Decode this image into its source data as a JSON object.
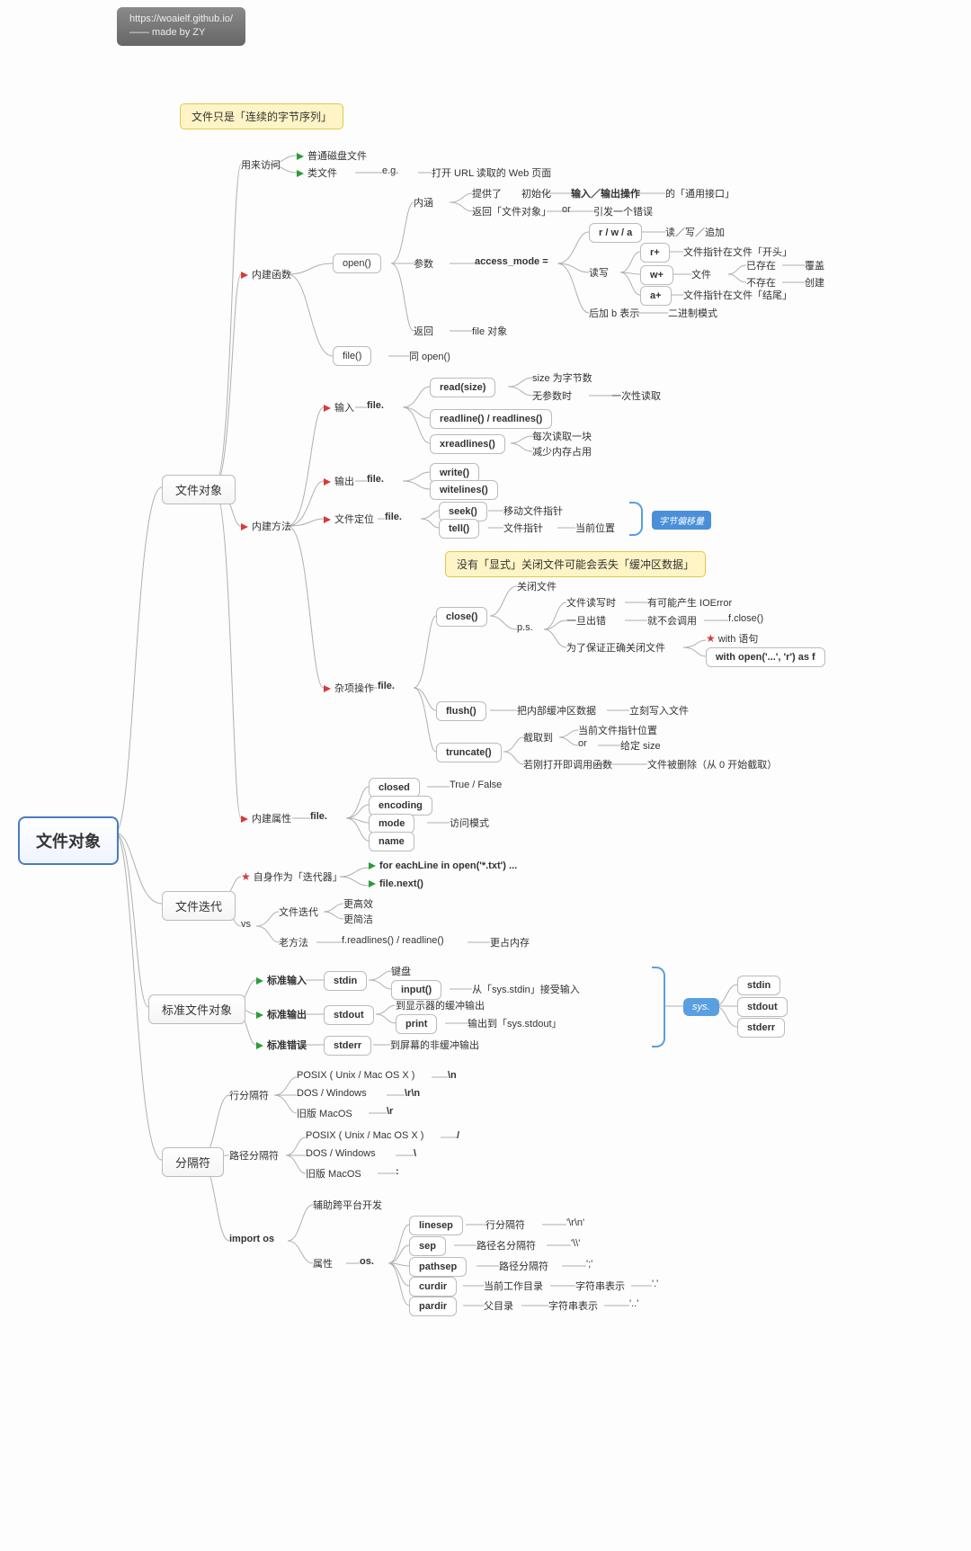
{
  "header": {
    "url": "https://woaielf.github.io/",
    "madeby": "—— made by ZY"
  },
  "root": "文件对象",
  "callouts": {
    "top": "文件只是「连续的字节序列」",
    "close": "没有「显式」关闭文件可能会丢失「缓冲区数据」",
    "offset": "字节偏移量"
  },
  "m1": {
    "title": "文件对象",
    "access": {
      "label": "用来访问",
      "a1": "普通磁盘文件",
      "a2": "类文件",
      "eg": "e.g.",
      "eg1": "打开 URL 读取的 Web 页面"
    },
    "builtinFunc": {
      "label": "内建函数",
      "open": "open()",
      "file": "file()",
      "sameopen": "同 open()",
      "inner": "内涵",
      "inner1": "提供了",
      "inner2": "初始化",
      "inner3": "输入／输出操作",
      "inner4": "的「通用接口」",
      "inner5": "返回「文件对象」",
      "inner6": "or",
      "inner7": "引发一个错误",
      "args": "参数",
      "access": "access_mode =",
      "rwa": "r / w / a",
      "rwa1": "读／写／追加",
      "rw": "读写",
      "rp": "r+",
      "rp1": "文件指针在文件「开头」",
      "wp": "w+",
      "wpf": "文件",
      "wpe": "已存在",
      "wpo": "覆盖",
      "wpne": "不存在",
      "wpc": "创建",
      "ap": "a+",
      "ap1": "文件指针在文件「结尾」",
      "bmode": "后加 b 表示",
      "bmode1": "二进制模式",
      "ret": "返回",
      "retv": "file 对象"
    },
    "builtinMethod": {
      "label": "内建方法",
      "input": "输入",
      "filep": "file.",
      "readsize": "read(size)",
      "rs1": "size 为字节数",
      "rs2": "无参数时",
      "rs3": "一次性读取",
      "readline": "readline() / readlines()",
      "xread": "xreadlines()",
      "xr1": "每次读取一块",
      "xr2": "减少内存占用",
      "output": "输出",
      "write": "write()",
      "writelines": "witelines()",
      "seek": "文件定位",
      "seekf": "seek()",
      "seek1": "移动文件指针",
      "tellf": "tell()",
      "tell1": "文件指针",
      "tell2": "当前位置",
      "misc": "杂项操作",
      "close": "close()",
      "close1": "关闭文件",
      "closeps": "p.s.",
      "c2": "文件读写时",
      "c3": "有可能产生 IOError",
      "c4": "一旦出错",
      "c5": "就不会调用",
      "c6": "f.close()",
      "c7": "为了保证正确关闭文件",
      "c8": "with 语句",
      "c9": "with open('...', 'r') as f",
      "flush": "flush()",
      "fl1": "把内部缓冲区数据",
      "fl2": "立刻写入文件",
      "trunc": "truncate()",
      "tr1": "截取到",
      "tr2": "当前文件指针位置",
      "tr3": "or",
      "tr4": "给定 size",
      "tr5": "若刚打开即调用函数",
      "tr6": "文件被删除（从 0 开始截取）"
    },
    "builtinAttr": {
      "label": "内建属性",
      "filep": "file.",
      "closed": "closed",
      "cv": "True / False",
      "encoding": "encoding",
      "mode": "mode",
      "mv": "访问模式",
      "name": "name"
    }
  },
  "m2": {
    "title": "文件迭代",
    "self": "自身作为「迭代器」",
    "fe": "for eachLine in open('*.txt') ...",
    "fn": "file.next()",
    "vs": "vs",
    "fi": "文件迭代",
    "fi1": "更高效",
    "fi2": "更简洁",
    "old": "老方法",
    "old1": "f.readlines() / readline()",
    "old2": "更占内存"
  },
  "m3": {
    "title": "标准文件对象",
    "si": "标准输入",
    "stdin": "stdin",
    "si1": "键盘",
    "si2": "input()",
    "si3": "从「sys.stdin」接受输入",
    "so": "标准输出",
    "stdout": "stdout",
    "so1": "到显示器的缓冲输出",
    "so2": "print",
    "so3": "输出到「sys.stdout」",
    "se": "标准错误",
    "stderr": "stderr",
    "se1": "到屏幕的非缓冲输出",
    "sys": "sys.",
    "ss1": "stdin",
    "ss2": "stdout",
    "ss3": "stderr"
  },
  "m4": {
    "title": "分隔符",
    "line": "行分隔符",
    "l1": "POSIX ( Unix / Mac OS X )",
    "l1v": "\\n",
    "l2": "DOS / Windows",
    "l2v": "\\r\\n",
    "l3": "旧版 MacOS",
    "l3v": "\\r",
    "path": "路径分隔符",
    "p1": "POSIX ( Unix / Mac OS X )",
    "p1v": "/",
    "p2": "DOS / Windows",
    "p2v": "\\",
    "p3": "旧版 MacOS",
    "p3v": ":",
    "imp": "import os",
    "aid": "辅助跨平台开发",
    "attr": "属性",
    "os": "os.",
    "a1": "linesep",
    "a1d": "行分隔符",
    "a1v": "'\\r\\n'",
    "a2": "sep",
    "a2d": "路径名分隔符",
    "a2v": "'\\\\'",
    "a3": "pathsep",
    "a3d": "路径分隔符",
    "a3v": "';'",
    "a4": "curdir",
    "a4d": "当前工作目录",
    "a4e": "字符串表示",
    "a4v": "'.'",
    "a5": "pardir",
    "a5d": "父目录",
    "a5e": "字符串表示",
    "a5v": "'..'"
  }
}
